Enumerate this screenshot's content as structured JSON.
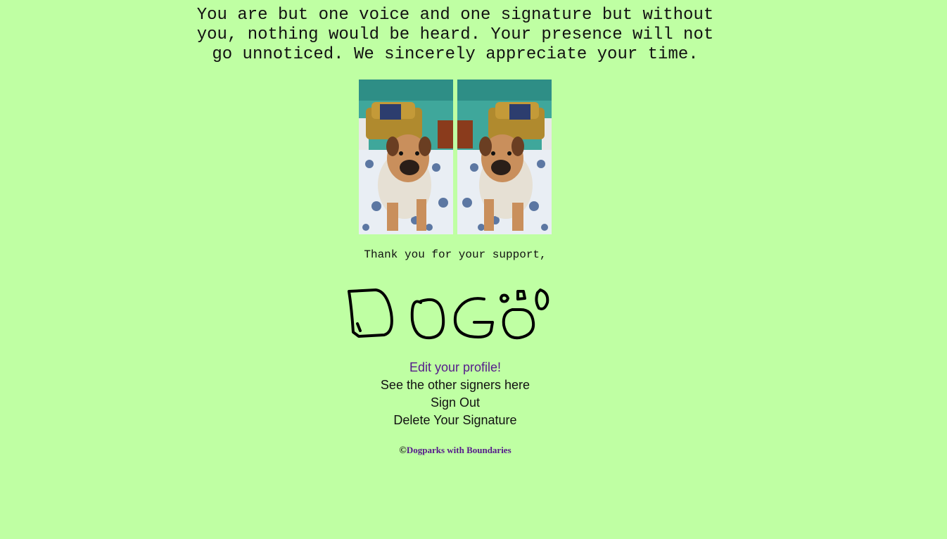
{
  "message": {
    "line1": "You are but one voice and one signature but without",
    "line2": "you, nothing would be heard. Your presence will not",
    "line3": "go unnoticed. We sincerely appreciate your time."
  },
  "images": {
    "left_alt": "dog photo",
    "right_alt": "dog photo mirrored"
  },
  "thanks": "Thank you for your support,",
  "signature": {
    "text": "DOGö"
  },
  "links": {
    "edit_profile": "Edit your profile!",
    "see_signers": "See the other signers here",
    "sign_out": "Sign Out",
    "delete_signature": "Delete Your Signature"
  },
  "footer": {
    "copyright_symbol": "©",
    "org_name": "Dogparks with Boundaries"
  },
  "colors": {
    "background": "#bfffa3",
    "visited_link": "#551a8b",
    "text": "#111111"
  }
}
